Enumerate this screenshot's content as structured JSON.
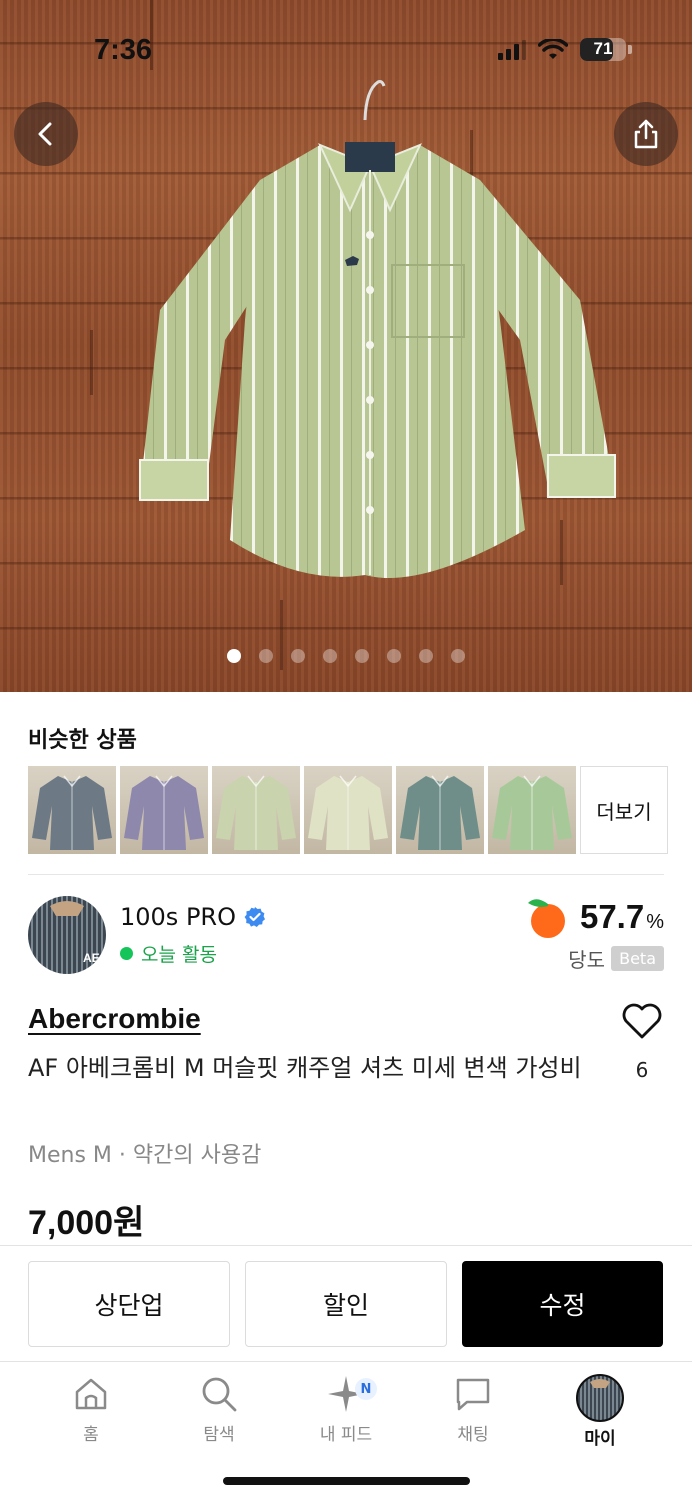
{
  "status_bar": {
    "time": "7:36",
    "battery": "71",
    "battery_level": 0.71
  },
  "hero": {
    "image_count": 8,
    "active_index": 0,
    "icons": {
      "back": "chevron-left-icon",
      "share": "share-icon"
    }
  },
  "similar": {
    "title": "비슷한 상품",
    "more_label": "더보기",
    "thumbs": [
      {
        "name": "similar-item-1",
        "color": "#6d7a86"
      },
      {
        "name": "similar-item-2",
        "color": "#8e88ad"
      },
      {
        "name": "similar-item-3",
        "color": "#c9d3ae"
      },
      {
        "name": "similar-item-4",
        "color": "#dfe2c4"
      },
      {
        "name": "similar-item-5",
        "color": "#6f8e8a"
      },
      {
        "name": "similar-item-6",
        "color": "#a7c99a"
      }
    ]
  },
  "seller": {
    "name": "100s PRO",
    "verified": true,
    "activity": "오늘 활동",
    "avatar_text": "AE",
    "dangdo_value": "57.7",
    "dangdo_unit": "%",
    "dangdo_label": "당도",
    "beta": "Beta"
  },
  "product": {
    "brand": "Abercrombie",
    "title": "AF 아베크롬비 M 머슬핏 캐주얼 셔츠 미세 변색 가성비",
    "meta": "Mens M · 약간의 사용감",
    "price": "7,000원",
    "likes": "6"
  },
  "actions": {
    "bump": "상단업",
    "discount": "할인",
    "edit": "수정"
  },
  "tabs": [
    {
      "label": "홈",
      "icon": "home-icon"
    },
    {
      "label": "탐색",
      "icon": "search-icon"
    },
    {
      "label": "내 피드",
      "icon": "sparkle-icon",
      "badge": "N"
    },
    {
      "label": "채팅",
      "icon": "chat-icon"
    },
    {
      "label": "마이",
      "icon": "avatar",
      "active": true
    }
  ],
  "colors": {
    "accent_green": "#16c55a",
    "verified_blue": "#3d8bf0",
    "primary_button": "#000000"
  }
}
